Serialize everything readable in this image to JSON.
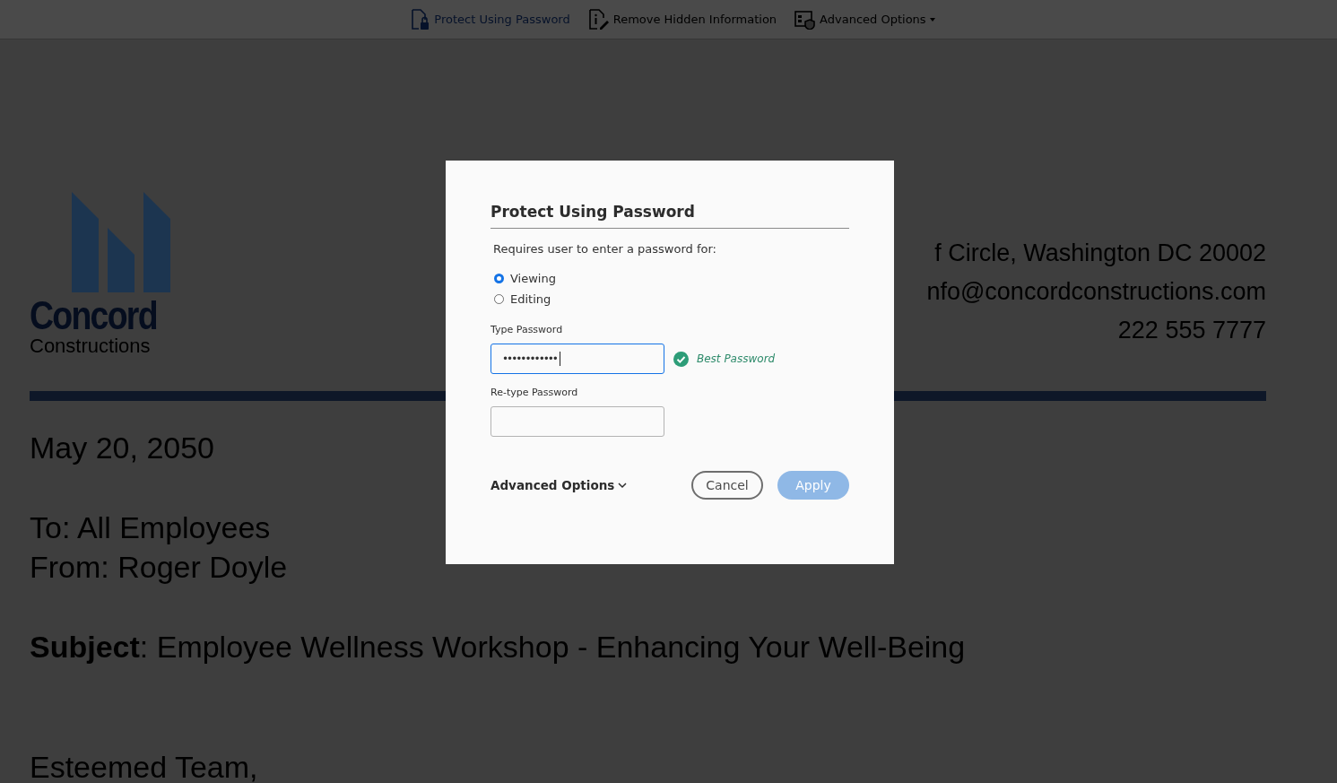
{
  "toolbar": {
    "tools": [
      {
        "label": "Protect Using Password",
        "kind": "protect",
        "selected": true
      },
      {
        "label": "Remove Hidden Information",
        "kind": "remove",
        "selected": false
      },
      {
        "label": "Advanced Options",
        "kind": "advanced",
        "selected": false,
        "dropdown": true
      }
    ]
  },
  "document": {
    "logo": {
      "name": "Concord",
      "tagline": "Constructions"
    },
    "address_lines": [
      "f Circle, Washington DC 20002",
      "nfo@concordconstructions.com",
      "222 555 7777"
    ],
    "date": "May 20, 2050",
    "to": "To: All Employees",
    "from": "From: Roger Doyle",
    "subject": "**Subject**: Employee Wellness Workshop - Enhancing Your Well-Being",
    "greeting": "Esteemed Team,"
  },
  "dialog": {
    "title": "Protect Using Password",
    "intro": "Requires user to enter a password for:",
    "options": [
      {
        "label": "Viewing",
        "selected": true
      },
      {
        "label": "Editing",
        "selected": false
      }
    ],
    "password_label": "Type Password",
    "password_value": "••••••••••••",
    "strength": "Best Password",
    "retype_label": "Re-type Password",
    "advanced": "Advanced Options",
    "cancel": "Cancel",
    "apply": {
      "label": "Apply",
      "disabled": true
    }
  }
}
